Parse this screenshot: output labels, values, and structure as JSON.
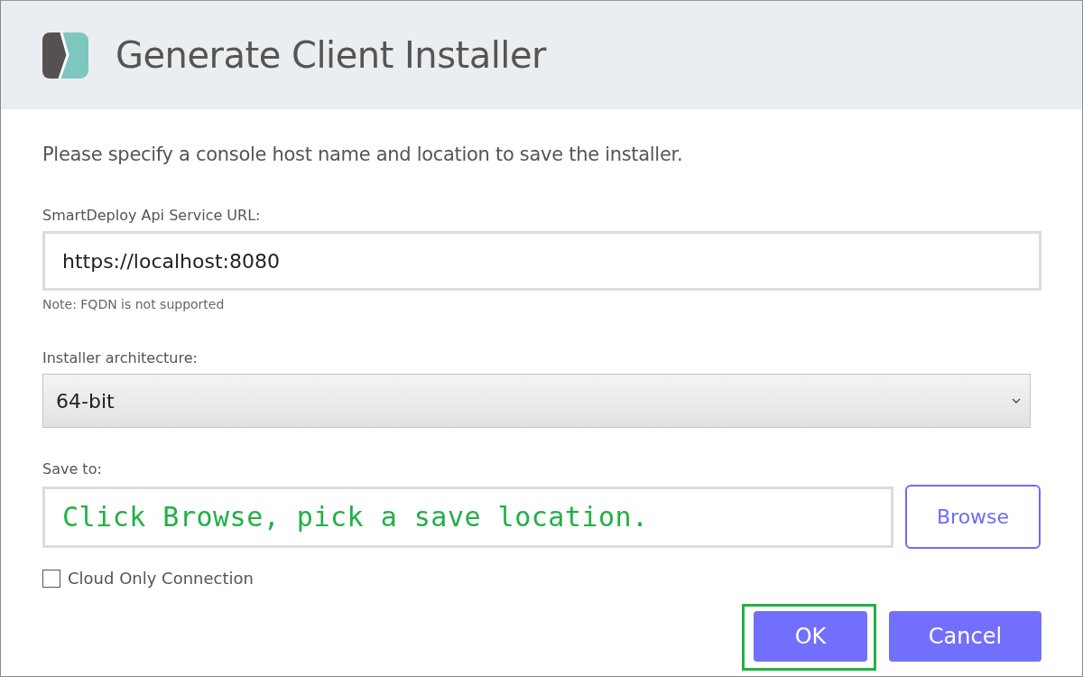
{
  "window": {
    "title": "Generate Client Installer"
  },
  "instruction": "Please specify a console host name and location to save the installer.",
  "url_field": {
    "label": "SmartDeploy Api Service URL:",
    "value": "https://localhost:8080",
    "note": "Note: FQDN is not supported"
  },
  "architecture": {
    "label": "Installer architecture:",
    "value": "64-bit"
  },
  "save_to": {
    "label": "Save to:",
    "annotation": "Click Browse, pick a save location.",
    "browse": "Browse"
  },
  "cloud_only": {
    "label": "Cloud Only Connection",
    "checked": false
  },
  "buttons": [
    {
      "label": "OK",
      "highlighted": true
    },
    {
      "label": "Cancel",
      "highlighted": false
    }
  ]
}
